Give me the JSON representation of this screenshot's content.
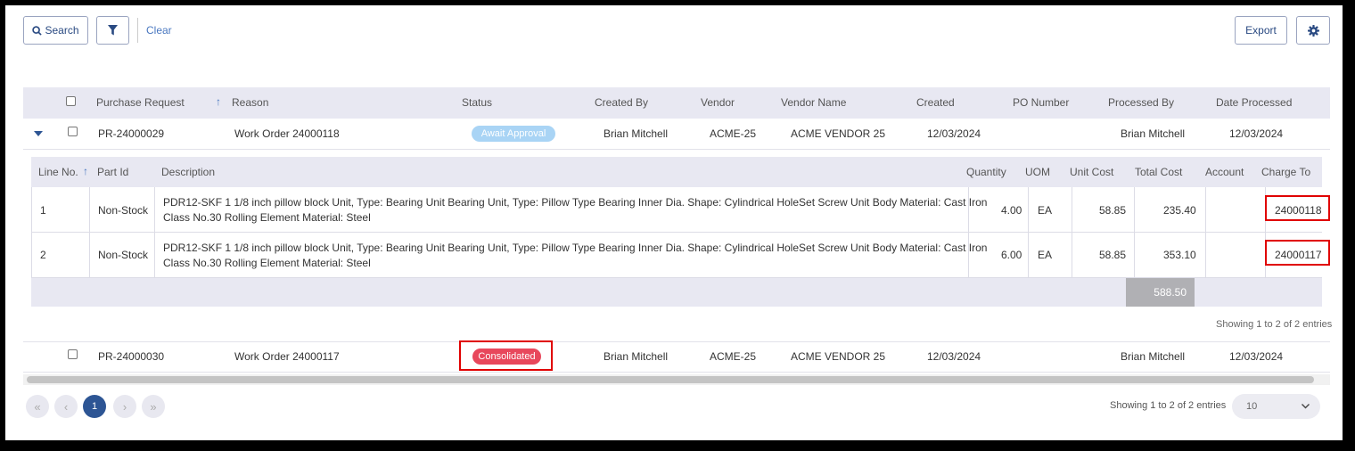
{
  "toolbar": {
    "search_label": "Search",
    "clear_label": "Clear",
    "export_label": "Export"
  },
  "table": {
    "headers": {
      "purchase_request": "Purchase Request",
      "reason": "Reason",
      "status": "Status",
      "created_by": "Created By",
      "vendor": "Vendor",
      "vendor_name": "Vendor Name",
      "created": "Created",
      "po_number": "PO Number",
      "processed_by": "Processed By",
      "date_processed": "Date Processed"
    },
    "rows": [
      {
        "pr": "PR-24000029",
        "reason": "Work Order 24000118",
        "status": "Await Approval",
        "created_by": "Brian Mitchell",
        "vendor": "ACME-25",
        "vendor_name": "ACME VENDOR 25",
        "created": "12/03/2024",
        "po_number": "",
        "processed_by": "Brian Mitchell",
        "date_processed": "12/03/2024"
      },
      {
        "pr": "PR-24000030",
        "reason": "Work Order 24000117",
        "status": "Consolidated",
        "created_by": "Brian Mitchell",
        "vendor": "ACME-25",
        "vendor_name": "ACME VENDOR 25",
        "created": "12/03/2024",
        "po_number": "",
        "processed_by": "Brian Mitchell",
        "date_processed": "12/03/2024"
      }
    ]
  },
  "lines": {
    "headers": {
      "line_no": "Line No.",
      "part_id": "Part Id",
      "description": "Description",
      "quantity": "Quantity",
      "uom": "UOM",
      "unit_cost": "Unit Cost",
      "total_cost": "Total Cost",
      "account": "Account",
      "charge_to": "Charge To"
    },
    "rows": [
      {
        "line_no": "1",
        "part_id": "Non-Stock",
        "desc_line1": "PDR12-SKF 1 1/8 inch pillow block Unit, Type: Bearing Unit Bearing Unit, Type: Pillow Type Bearing Inner Dia. Shape: Cylindrical HoleSet Screw Unit Body Material: Cast Iron",
        "desc_line2": "Class No.30 Rolling Element Material: Steel",
        "quantity": "4.00",
        "uom": "EA",
        "unit_cost": "58.85",
        "total_cost": "235.40",
        "account": "",
        "charge_to": "24000118"
      },
      {
        "line_no": "2",
        "part_id": "Non-Stock",
        "desc_line1": "PDR12-SKF 1 1/8 inch pillow block Unit, Type: Bearing Unit Bearing Unit, Type: Pillow Type Bearing Inner Dia. Shape: Cylindrical HoleSet Screw Unit Body Material: Cast Iron",
        "desc_line2": "Class No.30 Rolling Element Material: Steel",
        "quantity": "6.00",
        "uom": "EA",
        "unit_cost": "58.85",
        "total_cost": "353.10",
        "account": "",
        "charge_to": "24000117"
      }
    ],
    "total": "588.50",
    "showing": "Showing 1 to 2 of 2 entries"
  },
  "footer": {
    "showing": "Showing 1 to 2 of 2 entries",
    "page_size": "10",
    "current_page": "1"
  },
  "colors": {
    "await_badge": "#a9d4f5",
    "consolidated_badge": "#e8485c",
    "current_page": "#2d5594",
    "highlight": "#e00000"
  }
}
